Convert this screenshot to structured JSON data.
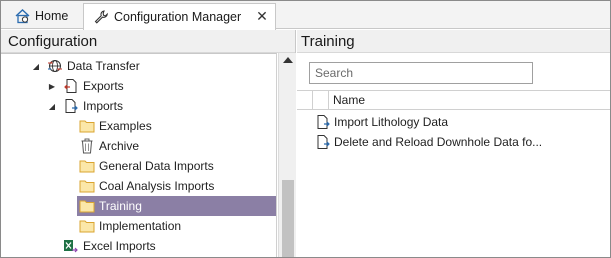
{
  "tabs": {
    "home_label": "Home",
    "config_label": "Configuration Manager",
    "close_glyph": "✕"
  },
  "left_pane": {
    "title": "Configuration",
    "tree": [
      {
        "label": "Data Transfer",
        "icon": "globe-transfer-icon",
        "expander": "expanded"
      },
      {
        "label": "Exports",
        "icon": "export-document-icon",
        "expander": "collapsed"
      },
      {
        "label": "Imports",
        "icon": "import-document-icon",
        "expander": "expanded"
      },
      {
        "label": "Examples",
        "icon": "folder-icon"
      },
      {
        "label": "Archive",
        "icon": "trash-can-icon"
      },
      {
        "label": "General Data Imports",
        "icon": "folder-icon"
      },
      {
        "label": "Coal Analysis Imports",
        "icon": "folder-icon"
      },
      {
        "label": "Training",
        "icon": "folder-icon",
        "selected": true
      },
      {
        "label": "Implementation",
        "icon": "folder-icon"
      },
      {
        "label": "Excel Imports",
        "icon": "excel-import-icon"
      }
    ]
  },
  "right_pane": {
    "title": "Training",
    "search_placeholder": "Search",
    "column_name": "Name",
    "rows": [
      {
        "label": "Import Lithology Data",
        "icon": "import-document-icon"
      },
      {
        "label": "Delete and Reload Downhole Data fo...",
        "icon": "import-document-icon"
      }
    ]
  },
  "colors": {
    "selection": "#8b7fa5",
    "folder": "#e8b84a"
  }
}
